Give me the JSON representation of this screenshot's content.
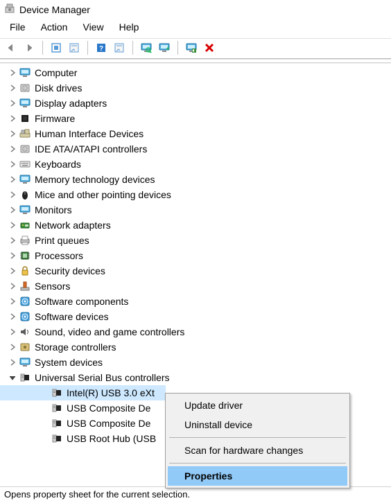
{
  "title": "Device Manager",
  "menu": {
    "file": "File",
    "action": "Action",
    "view": "View",
    "help": "Help"
  },
  "statusbar": "Opens property sheet for the current selection.",
  "tree": [
    {
      "label": "Computer",
      "icon": "computer",
      "exp": "r"
    },
    {
      "label": "Disk drives",
      "icon": "disk",
      "exp": "r"
    },
    {
      "label": "Display adapters",
      "icon": "monitor",
      "exp": "r"
    },
    {
      "label": "Firmware",
      "icon": "chip-dark",
      "exp": "r"
    },
    {
      "label": "Human Interface Devices",
      "icon": "hid",
      "exp": "r"
    },
    {
      "label": "IDE ATA/ATAPI controllers",
      "icon": "disk",
      "exp": "r"
    },
    {
      "label": "Keyboards",
      "icon": "keyboard",
      "exp": "r"
    },
    {
      "label": "Memory technology devices",
      "icon": "monitor",
      "exp": "r"
    },
    {
      "label": "Mice and other pointing devices",
      "icon": "mouse",
      "exp": "r"
    },
    {
      "label": "Monitors",
      "icon": "monitor",
      "exp": "r"
    },
    {
      "label": "Network adapters",
      "icon": "net",
      "exp": "r"
    },
    {
      "label": "Print queues",
      "icon": "printer",
      "exp": "r"
    },
    {
      "label": "Processors",
      "icon": "cpu",
      "exp": "r"
    },
    {
      "label": "Security devices",
      "icon": "lock",
      "exp": "r"
    },
    {
      "label": "Sensors",
      "icon": "sensor",
      "exp": "r"
    },
    {
      "label": "Software components",
      "icon": "soft",
      "exp": "r"
    },
    {
      "label": "Software devices",
      "icon": "soft",
      "exp": "r"
    },
    {
      "label": "Sound, video and game controllers",
      "icon": "speaker",
      "exp": "r"
    },
    {
      "label": "Storage controllers",
      "icon": "storage",
      "exp": "r"
    },
    {
      "label": "System devices",
      "icon": "monitor",
      "exp": "r"
    },
    {
      "label": "Universal Serial Bus controllers",
      "icon": "usb",
      "exp": "d",
      "children": [
        {
          "label": "Intel(R) USB 3.0 eXt",
          "icon": "usb",
          "sel": true,
          "clip": true
        },
        {
          "label": "USB Composite De",
          "icon": "usb",
          "clip": true
        },
        {
          "label": "USB Composite De",
          "icon": "usb",
          "clip": true
        },
        {
          "label": "USB Root Hub (USB",
          "icon": "usb",
          "clip": true
        }
      ]
    }
  ],
  "context_menu": {
    "update": "Update driver",
    "uninstall": "Uninstall device",
    "scan": "Scan for hardware changes",
    "properties": "Properties"
  },
  "icons": {
    "computer": "monitor-icon",
    "disk": "disk-icon",
    "monitor": "monitor-icon",
    "chip-dark": "chip-icon",
    "hid": "hid-icon",
    "keyboard": "keyboard-icon",
    "mouse": "mouse-icon",
    "net": "network-icon",
    "printer": "printer-icon",
    "cpu": "cpu-icon",
    "lock": "lock-icon",
    "sensor": "sensor-icon",
    "soft": "software-icon",
    "speaker": "speaker-icon",
    "storage": "storage-icon",
    "usb": "usb-icon"
  }
}
